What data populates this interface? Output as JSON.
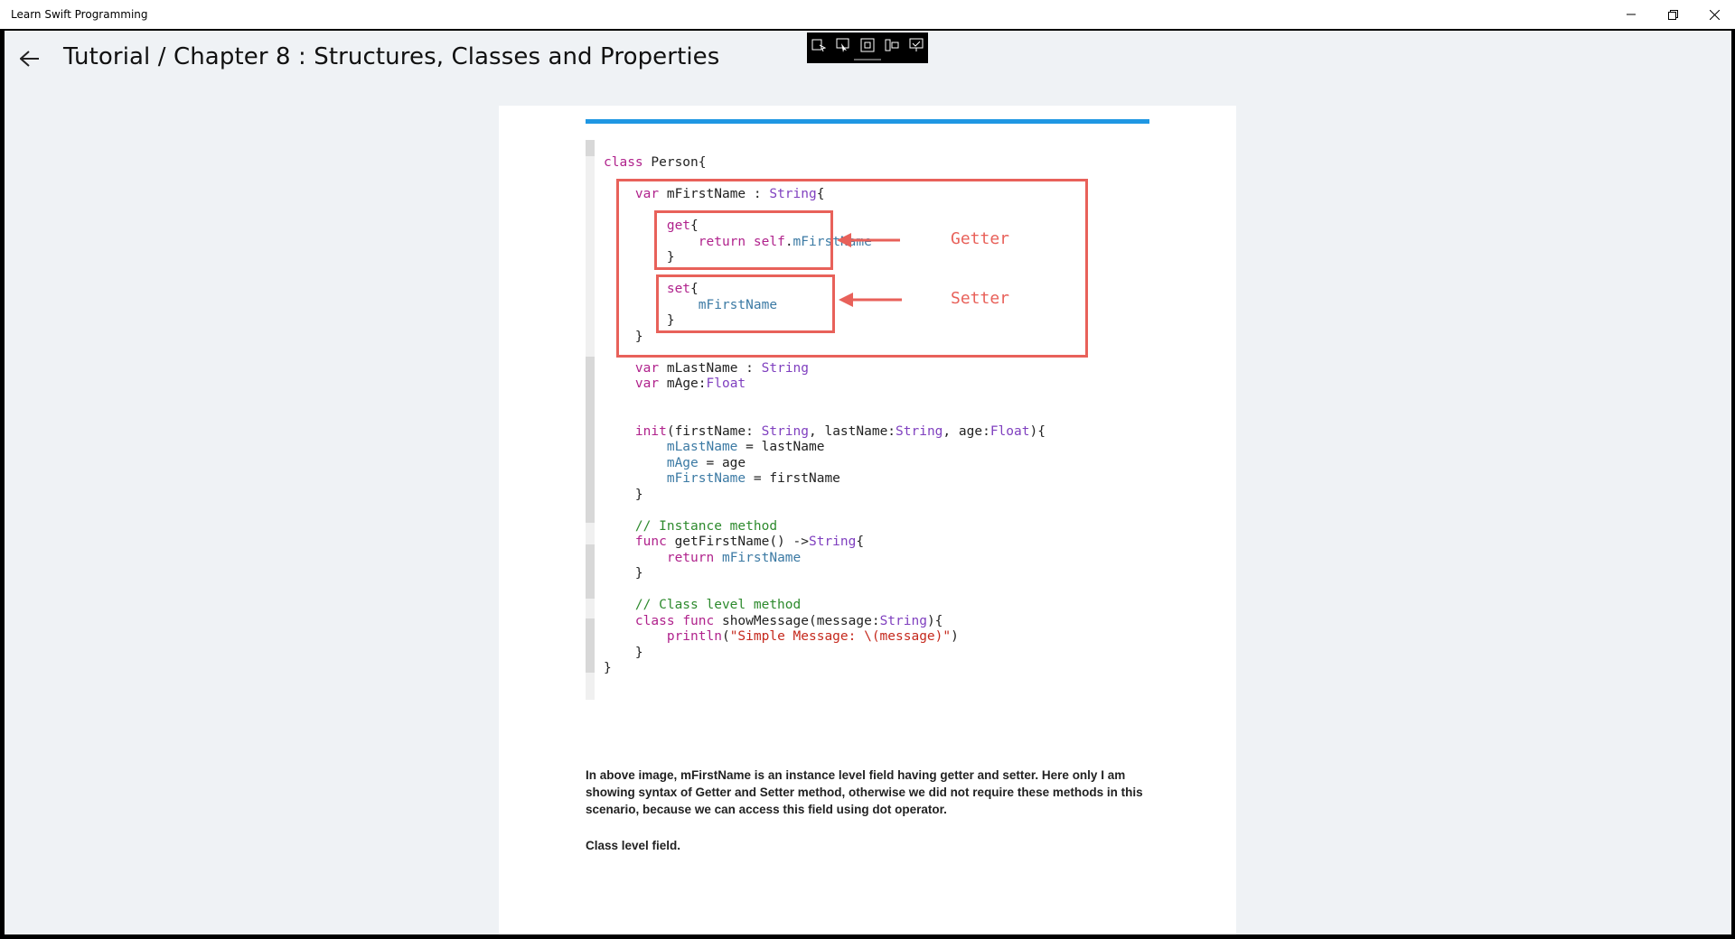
{
  "window": {
    "title": "Learn Swift Programming",
    "controls": [
      "minimize-icon",
      "restore-icon",
      "close-icon"
    ]
  },
  "header": {
    "back_icon": "arrow-left-icon",
    "title": "Tutorial / Chapter 8 :  Structures, Classes and Properties"
  },
  "floating_toolbar": {
    "icons": [
      "select-icon",
      "pointer-icon",
      "frame-icon",
      "inspect-icon",
      "track-icon"
    ]
  },
  "code_image": {
    "lines": [
      "class Person{",
      "",
      "    var mFirstName : String{",
      "",
      "        get{",
      "            return self.mFirstName",
      "        }",
      "",
      "        set{",
      "            mFirstName",
      "        }",
      "    }",
      "",
      "    var mLastName : String",
      "    var mAge:Float",
      "",
      "",
      "    init(firstName: String, lastName:String, age:Float){",
      "        mLastName = lastName",
      "        mAge = age",
      "        mFirstName = firstName",
      "    }",
      "",
      "    // Instance method",
      "    func getFirstName() ->String{",
      "        return mFirstName",
      "    }",
      "",
      "    // Class level method",
      "    class func showMessage(message:String){",
      "        println(\"Simple Message: \\(message)\")",
      "    }",
      "}"
    ],
    "annotations": {
      "getter": "Getter",
      "setter": "Setter"
    },
    "accent_color": "#e8615a"
  },
  "content": {
    "paragraph": "In above image, mFirstName is an instance level field having getter and setter. Here only I am showing syntax of Getter and Setter method, otherwise we did not require these methods in this scenario, because we can access this field using dot operator.",
    "subheading": "Class level field."
  },
  "colors": {
    "app_background": "#eff2f5",
    "top_bar_accent": "#1f97e3"
  }
}
